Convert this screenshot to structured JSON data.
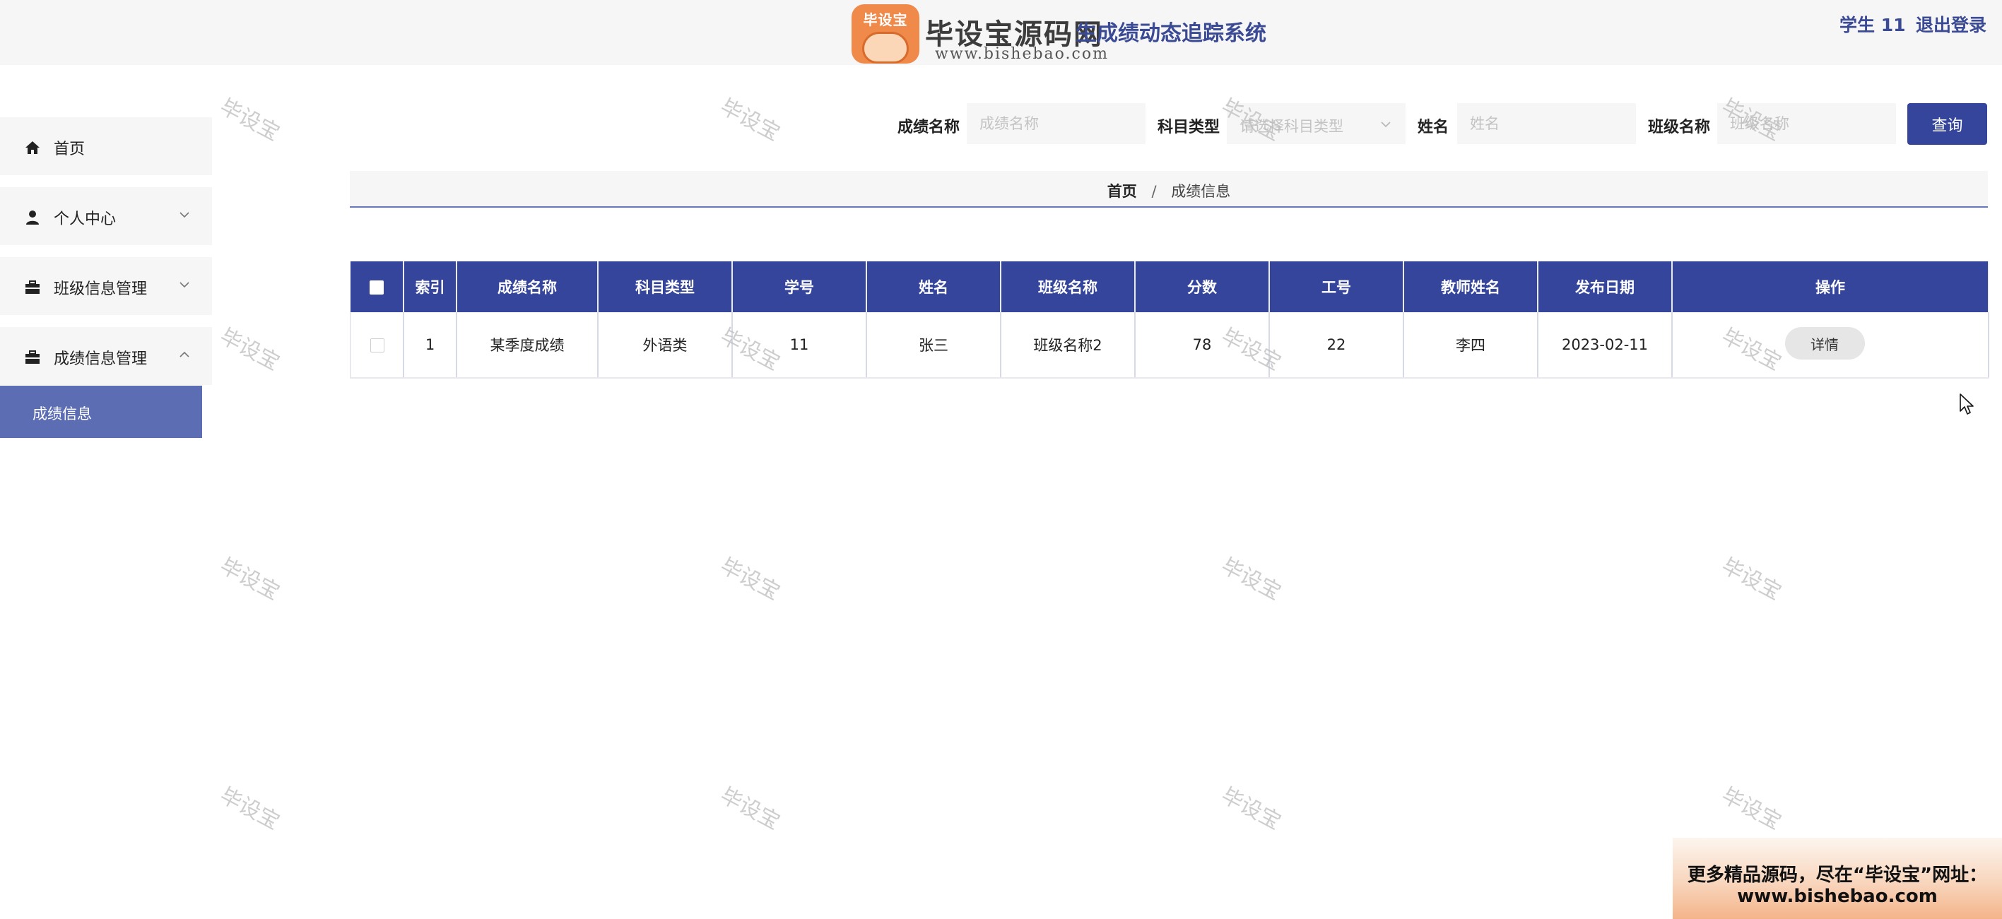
{
  "header": {
    "logo_badge": "毕设宝",
    "logo_title": "毕设宝源码网",
    "logo_url": "www.bishebao.com",
    "system_title": "生成绩动态追踪系统",
    "user_name": "学生 11",
    "logout_label": "退出登录"
  },
  "sidebar": {
    "items": [
      {
        "label": "首页",
        "icon": "home-icon"
      },
      {
        "label": "个人中心",
        "icon": "user-icon"
      },
      {
        "label": "班级信息管理",
        "icon": "briefcase-icon"
      },
      {
        "label": "成绩信息管理",
        "icon": "briefcase-icon"
      }
    ],
    "active_sub_item": "成绩信息"
  },
  "search": {
    "score_name_label": "成绩名称",
    "score_name_placeholder": "成绩名称",
    "subject_type_label": "科目类型",
    "subject_type_placeholder": "请选择科目类型",
    "name_label": "姓名",
    "name_placeholder": "姓名",
    "class_name_label": "班级名称",
    "class_name_placeholder": "班级名称",
    "query_button": "查询"
  },
  "breadcrumb": {
    "home": "首页",
    "separator": "/",
    "current": "成绩信息"
  },
  "table": {
    "columns": [
      "索引",
      "成绩名称",
      "科目类型",
      "学号",
      "姓名",
      "班级名称",
      "分数",
      "工号",
      "教师姓名",
      "发布日期",
      "操作"
    ],
    "rows": [
      {
        "index": "1",
        "score_name": "某季度成绩",
        "subject_type": "外语类",
        "student_no": "11",
        "student_name": "张三",
        "class_name": "班级名称2",
        "score": "78",
        "staff_no": "22",
        "teacher_name": "李四",
        "publish_date": "2023-02-11",
        "action_label": "详情"
      }
    ]
  },
  "watermark_text": "毕设宝",
  "ad_banner": {
    "line1": "更多精品源码，尽在“毕设宝”网址：",
    "line2": "www.bishebao.com"
  },
  "colors": {
    "primary": "#34459b",
    "sidebar_active": "#5c6db3",
    "panel_bg": "#f7f6f7"
  }
}
